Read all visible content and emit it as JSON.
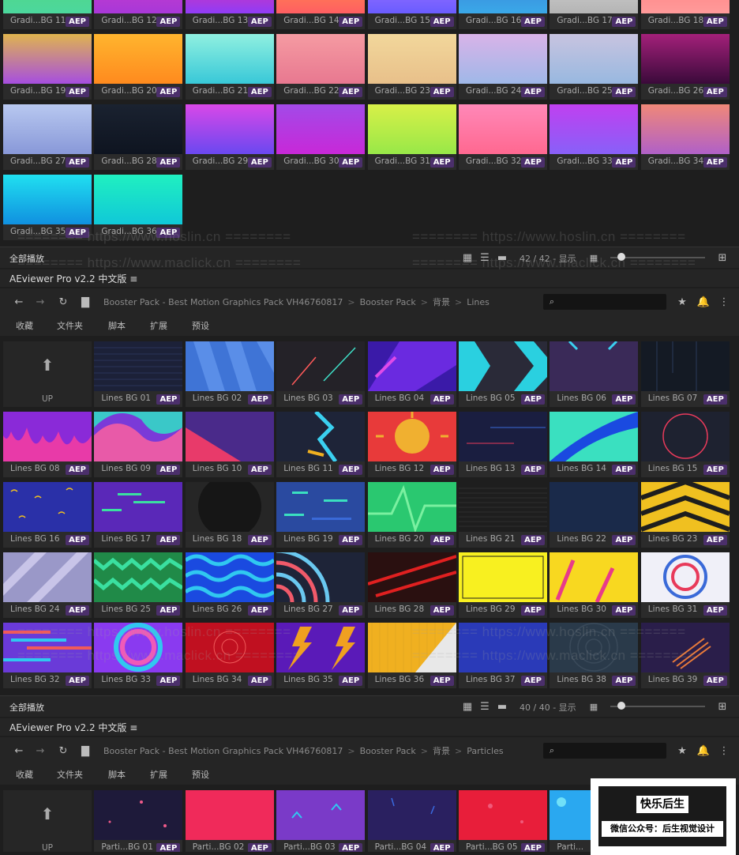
{
  "badge": "AEP",
  "up_label": "UP",
  "gradient_names": [
    "Gradi...BG 11",
    "Gradi...BG 12",
    "Gradi...BG 13",
    "Gradi...BG 14",
    "Gradi...BG 15",
    "Gradi...BG 16",
    "Gradi...BG 17",
    "Gradi...BG 18",
    "Gradi...BG 19",
    "Gradi...BG 20",
    "Gradi...BG 21",
    "Gradi...BG 22",
    "Gradi...BG 23",
    "Gradi...BG 24",
    "Gradi...BG 25",
    "Gradi...BG 26",
    "Gradi...BG 27",
    "Gradi...BG 28",
    "Gradi...BG 29",
    "Gradi...BG 30",
    "Gradi...BG 31",
    "Gradi...BG 32",
    "Gradi...BG 33",
    "Gradi...BG 34",
    "Gradi...BG 35",
    "Gradi...BG 36"
  ],
  "gradient_colors": [
    [
      "#54d87a",
      "#4cd79d"
    ],
    [
      "#d43cc6",
      "#a838d8"
    ],
    [
      "#ff2f8f",
      "#8f3cf7"
    ],
    [
      "#ff9f43",
      "#ff5e62"
    ],
    [
      "#b37bff",
      "#6a5cff"
    ],
    [
      "#3a7bd5",
      "#3aa8e8"
    ],
    [
      "#dcdcdc",
      "#b4b4b4"
    ],
    [
      "#ff7a7a",
      "#ff9a9a"
    ],
    [
      "#e0b44f",
      "#a64ee0"
    ],
    [
      "#ffb52e",
      "#ff8a1e"
    ],
    [
      "#90f0e0",
      "#38c8d8"
    ],
    [
      "#f59ba2",
      "#e87890"
    ],
    [
      "#f2d79b",
      "#e8c08a"
    ],
    [
      "#d9b3e8",
      "#9fb8e8"
    ],
    [
      "#c8c4e0",
      "#98b8e0"
    ],
    [
      "#a3207a",
      "#3a0a3a"
    ],
    [
      "#b8c8f0",
      "#8898d8"
    ],
    [
      "#1a2230",
      "#0e1420"
    ],
    [
      "#d948e8",
      "#6a48f0"
    ],
    [
      "#a24ae8",
      "#c828d8"
    ],
    [
      "#d8f048",
      "#98e848"
    ],
    [
      "#ff88b8",
      "#ff6890"
    ],
    [
      "#c040f0",
      "#8860f8"
    ],
    [
      "#f08878",
      "#b060c8"
    ],
    [
      "#20e0f0",
      "#1090e0"
    ],
    [
      "#20f0c0",
      "#10c8d8"
    ]
  ],
  "lines_names": [
    "Lines BG 01",
    "Lines BG 02",
    "Lines BG 03",
    "Lines BG 04",
    "Lines BG 05",
    "Lines BG 06",
    "Lines BG 07",
    "Lines BG 08",
    "Lines BG 09",
    "Lines BG 10",
    "Lines BG 11",
    "Lines BG 12",
    "Lines BG 13",
    "Lines BG 14",
    "Lines BG 15",
    "Lines BG 16",
    "Lines BG 17",
    "Lines BG 18",
    "Lines BG 19",
    "Lines BG 20",
    "Lines BG 21",
    "Lines BG 22",
    "Lines BG 23",
    "Lines BG 24",
    "Lines BG 25",
    "Lines BG 26",
    "Lines BG 27",
    "Lines BG 28",
    "Lines BG 29",
    "Lines BG 30",
    "Lines BG 31",
    "Lines BG 32",
    "Lines BG 33",
    "Lines BG 34",
    "Lines BG 35",
    "Lines BG 36",
    "Lines BG 37",
    "Lines BG 38",
    "Lines BG 39"
  ],
  "particles_names": [
    "Parti...BG 01",
    "Parti...BG 02",
    "Parti...BG 03",
    "Parti...BG 04",
    "Parti...BG 05",
    "Parti..."
  ],
  "status1": {
    "all": "全部播放",
    "count": "42 / 42 - 显示"
  },
  "status2": {
    "all": "全部播放",
    "count": "40 / 40 - 显示"
  },
  "panel1": {
    "title": "AEviewer Pro v2.2 中文版",
    "crumbs": [
      "Booster Pack - Best Motion Graphics Pack VH46760817",
      "Booster Pack",
      "背景",
      "Lines"
    ],
    "menu": [
      "收藏",
      "文件夹",
      "脚本",
      "扩展",
      "预设"
    ]
  },
  "panel2": {
    "title": "AEviewer Pro v2.2 中文版",
    "crumbs": [
      "Booster Pack - Best Motion Graphics Pack VH46760817",
      "Booster Pack",
      "背景",
      "Particles"
    ],
    "menu": [
      "收藏",
      "文件夹",
      "脚本",
      "扩展",
      "预设"
    ]
  },
  "watermarks": {
    "hoslin": "======== https://www.hoslin.cn ========",
    "maclick": "======== https://www.maclick.cn ========"
  },
  "stamp": {
    "line1": "快乐后生",
    "line2": "微信公众号：后生视觉设计"
  }
}
